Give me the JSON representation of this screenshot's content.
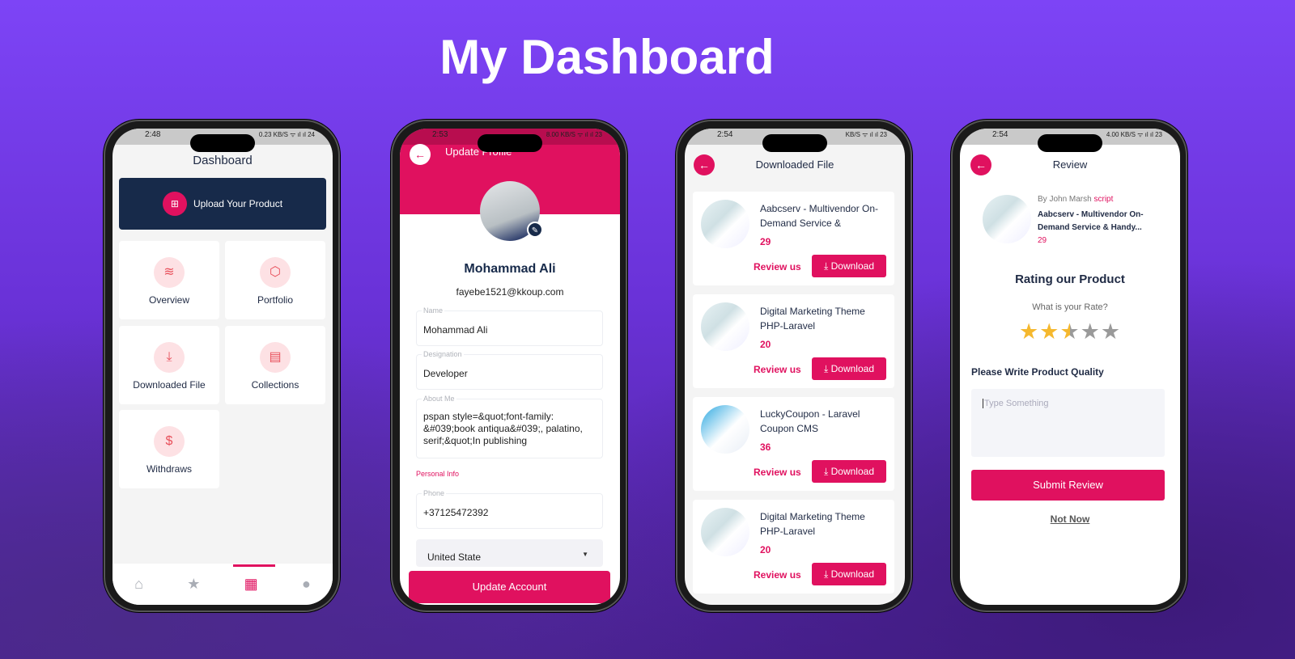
{
  "page_title": "My Dashboard",
  "colors": {
    "accent": "#e0115f",
    "navy": "#172a4a",
    "background": "#7d44f6"
  },
  "phone1": {
    "time": "2:48",
    "status_right": "0.23 KB/S ᯤ ıl ıl 24",
    "title": "Dashboard",
    "upload_label": "Upload Your Product",
    "tiles": [
      {
        "label": "Overview",
        "icon": "layers-icon"
      },
      {
        "label": "Portfolio",
        "icon": "box-icon"
      },
      {
        "label": "Downloaded File",
        "icon": "download-icon"
      },
      {
        "label": "Collections",
        "icon": "folder-icon"
      },
      {
        "label": "Withdraws",
        "icon": "hand-money-icon"
      }
    ],
    "nav": [
      "home-icon",
      "star-icon",
      "dashboard-icon",
      "user-icon"
    ],
    "nav_active": 2
  },
  "phone2": {
    "time": "2:53",
    "status_right": "8.00 KB/S ᯤ ıl ıl 23",
    "title": "Update Profile",
    "name": "Mohammad Ali",
    "email": "fayebe1521@kkoup.com",
    "fields": {
      "name_label": "Name",
      "name_value": "Mohammad Ali",
      "designation_label": "Designation",
      "designation_value": "Developer",
      "about_label": "About Me",
      "about_value": "pspan style=&quot;font-family: &#039;book antiqua&#039;, palatino, serif;&quot;In publishing",
      "section": "Personal Info",
      "phone_label": "Phone",
      "phone_value": "+37125472392",
      "country_value": "United State"
    },
    "button": "Update Account"
  },
  "phone3": {
    "time": "2:54",
    "status_right": "KB/S ᯤ ıl ıl 23",
    "title": "Downloaded File",
    "review_label": "Review us",
    "download_label": "Download",
    "items": [
      {
        "title": "Aabcserv - Multivendor On-Demand Service &",
        "count": "29"
      },
      {
        "title": "Digital Marketing Theme PHP-Laravel",
        "count": "20"
      },
      {
        "title": "LuckyCoupon - Laravel Coupon CMS",
        "count": "36"
      },
      {
        "title": "Digital Marketing Theme PHP-Laravel",
        "count": "20"
      }
    ]
  },
  "phone4": {
    "time": "2:54",
    "status_right": "4.00 KB/S ᯤ ıl ıl 23",
    "title": "Review",
    "by": "By John Marsh",
    "category": "script",
    "product": "Aabcserv - Multivendor On-Demand Service & Handy...",
    "count": "29",
    "rating_title": "Rating our Product",
    "rating_question": "What is your Rate?",
    "rating": 2.5,
    "rating_max": 5,
    "quality_label": "Please Write Product Quality",
    "placeholder": "Type Something",
    "submit": "Submit Review",
    "not_now": "Not Now"
  }
}
